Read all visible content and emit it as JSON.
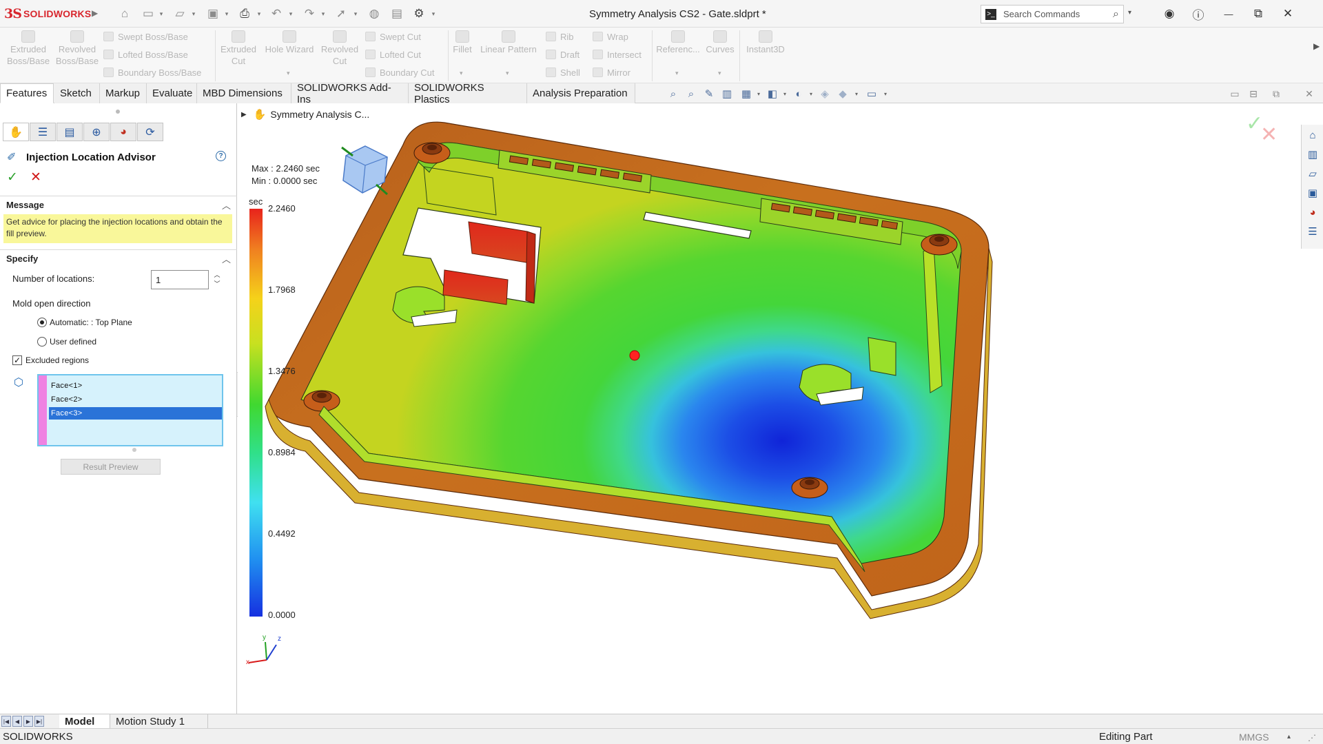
{
  "app": {
    "brand": "SOLIDWORKS",
    "brand_mark": "3S",
    "document_title": "Symmetry Analysis CS2 - Gate.sldprt *",
    "search_placeholder": "Search Commands",
    "accent": "#d8262d"
  },
  "command_manager": {
    "groups": [
      {
        "label": "Extruded\nBoss/Base"
      },
      {
        "label": "Revolved\nBoss/Base"
      },
      {
        "label": "Extruded\nCut"
      },
      {
        "label": "Hole Wizard"
      },
      {
        "label": "Revolved\nCut"
      },
      {
        "label": "Fillet"
      },
      {
        "label": "Linear Pattern"
      },
      {
        "label": "Referenc..."
      },
      {
        "label": "Curves"
      },
      {
        "label": "Instant3D"
      }
    ],
    "small": [
      "Swept Boss/Base",
      "Lofted Boss/Base",
      "Boundary Boss/Base",
      "Swept Cut",
      "Lofted Cut",
      "Boundary Cut",
      "Rib",
      "Draft",
      "Shell",
      "Wrap",
      "Intersect",
      "Mirror"
    ]
  },
  "tabs": [
    "Features",
    "Sketch",
    "Markup",
    "Evaluate",
    "MBD Dimensions",
    "SOLIDWORKS Add-Ins",
    "SOLIDWORKS Plastics",
    "Analysis Preparation"
  ],
  "property_manager": {
    "title": "Injection Location Advisor",
    "message_header": "Message",
    "message_text": "Get advice for placing the injection locations and obtain the fill preview.",
    "specify_header": "Specify",
    "num_locations_label": "Number of locations:",
    "num_locations_value": "1",
    "mold_open_label": "Mold open direction",
    "option_automatic": "Automatic: : Top Plane",
    "option_user": "User defined",
    "excluded_label": "Excluded regions",
    "faces": [
      "Face<1>",
      "Face<2>",
      "Face<3>"
    ],
    "result_preview": "Result Preview"
  },
  "graphics": {
    "tree_item": "Symmetry Analysis C...",
    "max_text": "Max : 2.2460 sec",
    "min_text": "Min : 0.0000 sec",
    "unit": "sec",
    "legend": [
      "2.2460",
      "1.7968",
      "1.3476",
      "0.8984",
      "0.4492",
      "0.0000"
    ],
    "triad": {
      "x": "x",
      "y": "y",
      "z": "z"
    }
  },
  "bottom_tabs": [
    "Model",
    "Motion Study 1"
  ],
  "status": {
    "app": "SOLIDWORKS",
    "mode": "Editing Part",
    "units": "MMGS"
  }
}
